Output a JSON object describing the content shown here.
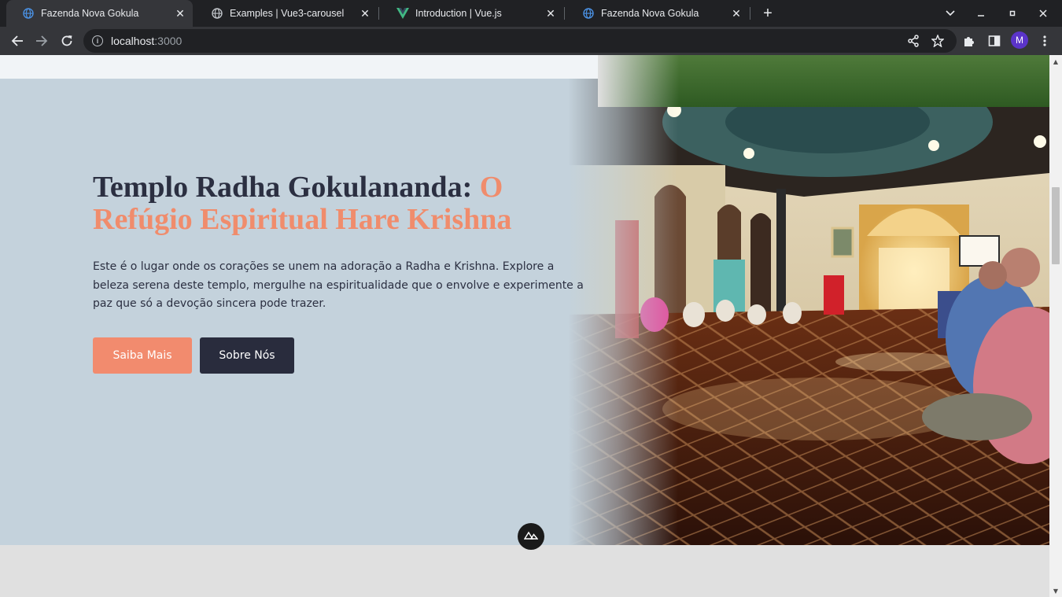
{
  "browser": {
    "tabs": [
      {
        "title": "Fazenda Nova Gokula",
        "icon": "globe-blue-icon",
        "active": true
      },
      {
        "title": "Examples | Vue3-carousel",
        "icon": "globe-icon",
        "active": false
      },
      {
        "title": "Introduction | Vue.js",
        "icon": "vue-logo-icon",
        "active": false
      },
      {
        "title": "Fazenda Nova Gokula",
        "icon": "globe-blue-icon",
        "active": false
      }
    ],
    "url_host": "localhost",
    "url_port": ":3000",
    "profile_initial": "M"
  },
  "hero": {
    "title_main": "Templo Radha Gokulananda: ",
    "title_accent": "O Refúgio Espiritual Hare Krishna",
    "description": "Este é o lugar onde os corações se unem na adoração a Radha e Krishna. Explore a beleza serena deste templo, mergulhe na espiritualidade que o envolve e experimente a paz que só a devoção sincera pode trazer.",
    "primary_button": "Saiba Mais",
    "secondary_button": "Sobre Nós"
  },
  "colors": {
    "accent": "#f08c6c",
    "dark": "#2b2f41",
    "hero_bg": "#c4d2dc"
  }
}
